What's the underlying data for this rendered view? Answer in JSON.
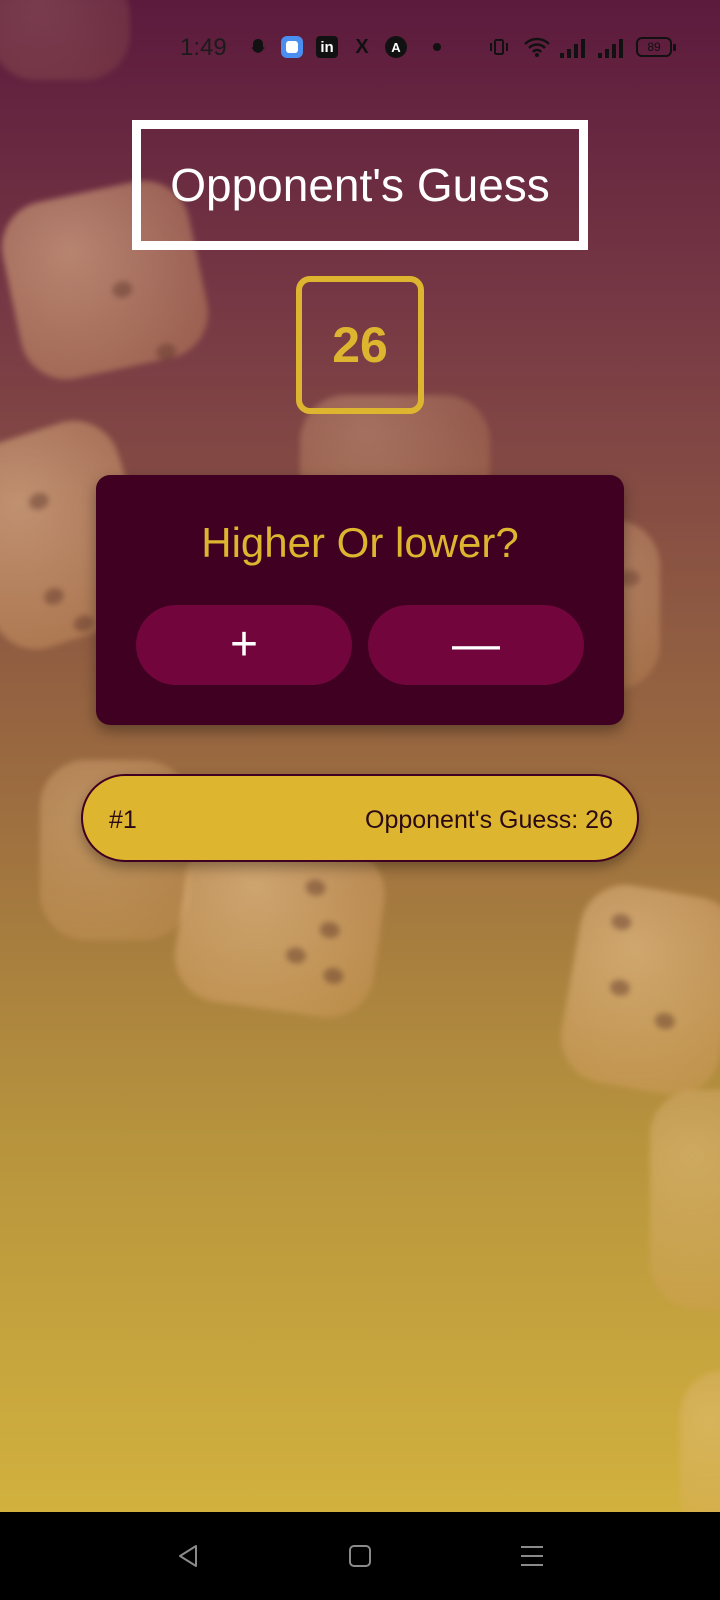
{
  "status_bar": {
    "time": "1:49",
    "icons": [
      "snapchat-icon",
      "app-icon",
      "linkedin-icon",
      "x-icon",
      "app-a-icon",
      "dot-icon",
      "vibrate-icon",
      "wifi-icon",
      "signal-icon",
      "signal-icon"
    ],
    "linkedin_label": "in",
    "x_label": "X",
    "a_label": "A",
    "battery": "89"
  },
  "screen": {
    "title": "Opponent's Guess",
    "current_guess": "26",
    "prompt": "Higher Or lower?",
    "higher_label": "+",
    "lower_label": "—"
  },
  "guess_log": [
    {
      "round": "#1",
      "text": "Opponent's Guess: 26"
    }
  ],
  "colors": {
    "accent_gold": "#ddb52f",
    "card_bg": "#3f0022",
    "button_bg": "#72063c",
    "title_text": "#ffffff"
  },
  "nav_bar": {
    "icons": [
      "back-icon",
      "home-icon",
      "recents-icon"
    ]
  }
}
